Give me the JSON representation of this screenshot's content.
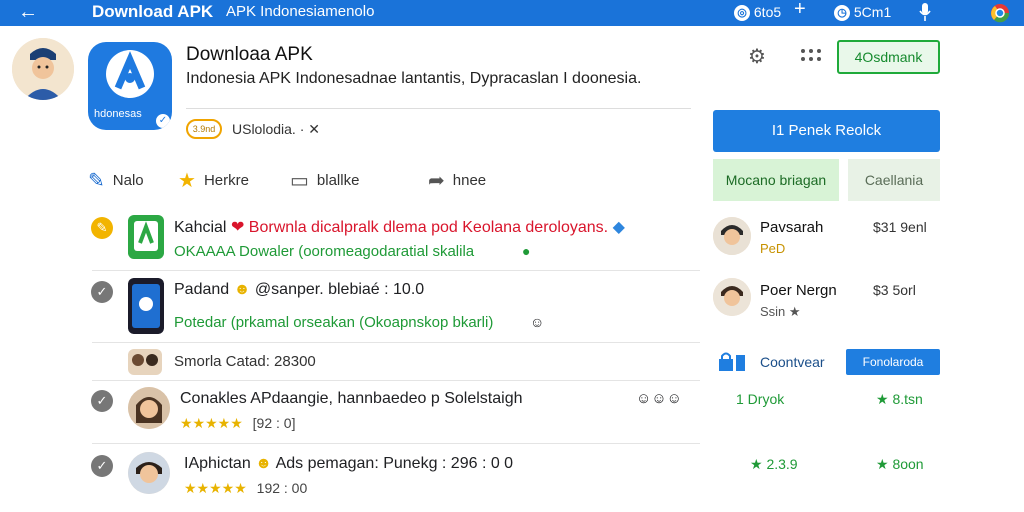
{
  "topbar": {
    "back_icon": "arrow-left-icon",
    "title": "Download APK",
    "subtitle": "APK Indonesiamenolo",
    "ctl1": "6to5",
    "ctl2": "5Cm1",
    "add_glyph": "+"
  },
  "header": {
    "app_name": "Downloaa APK",
    "description": "Indonesia APK Indonesadnae lantantis, Dypracaslan I doonesia.",
    "icon_label": "hdonesas",
    "rating_pill": "3.9nd",
    "stat_line": "USlolodia. · ✕",
    "follow_label": "4Osdmank",
    "primary_label": "I1 Penek Reolck",
    "secondary_green": "Mocano briagan",
    "secondary_grey": "Caellania"
  },
  "actions": [
    {
      "label": "Nalo",
      "icon": "edit-icon"
    },
    {
      "label": "Herkre",
      "icon": "star-icon"
    },
    {
      "label": "blallke",
      "icon": "comment-icon"
    },
    {
      "label": "hnee",
      "icon": "share-icon"
    }
  ],
  "feed": [
    {
      "title_a": "Kahcial",
      "title_b": "Borwnla dicalpralk dlema pod Keolana deroloyans.",
      "line2": "OKAAAA Dowaler (ooromeagodaratial skalila",
      "status": "pending"
    },
    {
      "title": "Padand",
      "handle": "@sanper. blebiaé : 10.0",
      "line2": "Potedar (prkamal orseakan (Okoapnskop bkarli)",
      "status": "checked"
    },
    {
      "title": "Smorla Catad: 28300"
    },
    {
      "title": "Conakles APdaangie, hannbaedeo p Solelstaigh",
      "rating": "★★★★★",
      "meta": "[92 : 0]",
      "status": "checked"
    },
    {
      "title_a": "IAphictan",
      "title_b": "Ads pemagan: Punekg : 296 : 0 0",
      "rating": "★★★★★",
      "meta": "192 : 00",
      "status": "checked"
    }
  ],
  "right": {
    "u1_name": "Pavsarah",
    "u1_sub": "PeD",
    "u1_meta": "$31 9enl",
    "u2_name": "Poer Nergn",
    "u2_sub": "Ssin ★",
    "u2_meta": "$3 5orl",
    "section_label": "Coontvear",
    "section_chip": "Fonolaroda",
    "r1": "1 Dryok",
    "r1b": "★ 8.tsn",
    "r2": "★ 2.3.9",
    "r2b": "★ 8oon"
  },
  "colors": {
    "accent": "#1a73d9",
    "green": "#1faa3a",
    "star": "#e8b300",
    "red": "#d9152c"
  }
}
